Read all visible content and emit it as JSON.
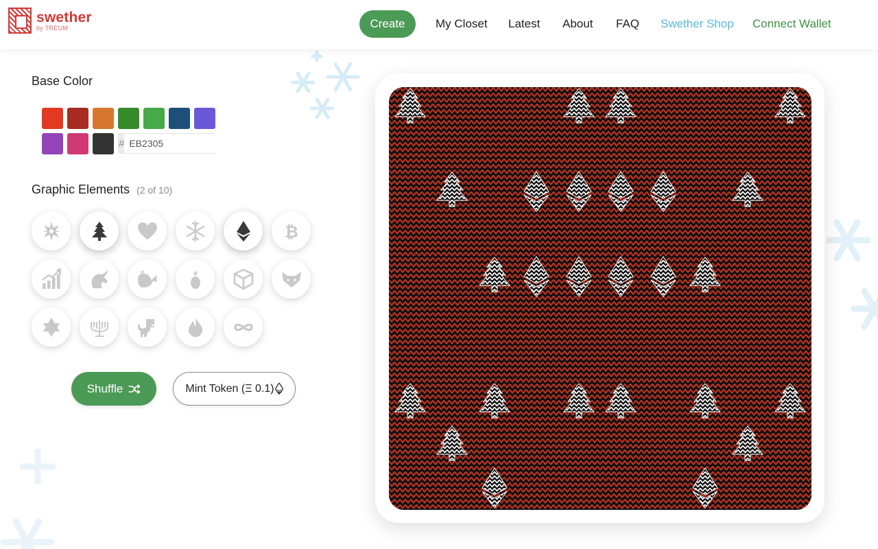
{
  "brand": {
    "name": "swether",
    "tagline": "by TREUM"
  },
  "nav": {
    "create": "Create",
    "my_closet": "My Closet",
    "latest": "Latest",
    "about": "About",
    "faq": "FAQ",
    "shop": "Swether Shop",
    "wallet": "Connect Wallet"
  },
  "base_color": {
    "title": "Base Color",
    "swatches": [
      "#e23a22",
      "#a72d22",
      "#d8772e",
      "#368a2c",
      "#46aa48",
      "#1f4f78",
      "#6a58d8",
      "#9344b6",
      "#cf3a72",
      "#333333"
    ],
    "hash": "#",
    "value": "EB2305"
  },
  "graphic_elements": {
    "title": "Graphic Elements",
    "count": "(2 of 10)",
    "items": [
      "star-icon",
      "tree-icon",
      "heart-icon",
      "snowflake-icon",
      "ethereum-icon",
      "bitcoin-icon",
      "chart-icon",
      "unicorn-icon",
      "whale-icon",
      "pineapple-icon",
      "cube-icon",
      "fox-icon",
      "star-of-david-icon",
      "menorah-icon",
      "dinosaur-icon",
      "flame-icon",
      "infinity-icon"
    ],
    "selected": [
      "tree-icon",
      "ethereum-icon"
    ]
  },
  "actions": {
    "shuffle": "Shuffle",
    "mint": "Mint Token (Ξ 0.1)"
  },
  "colors": {
    "accent_green": "#4b9a55",
    "shop_blue": "#5ab6df",
    "brand_red": "#d33a36",
    "knit_red": "#c13422"
  }
}
